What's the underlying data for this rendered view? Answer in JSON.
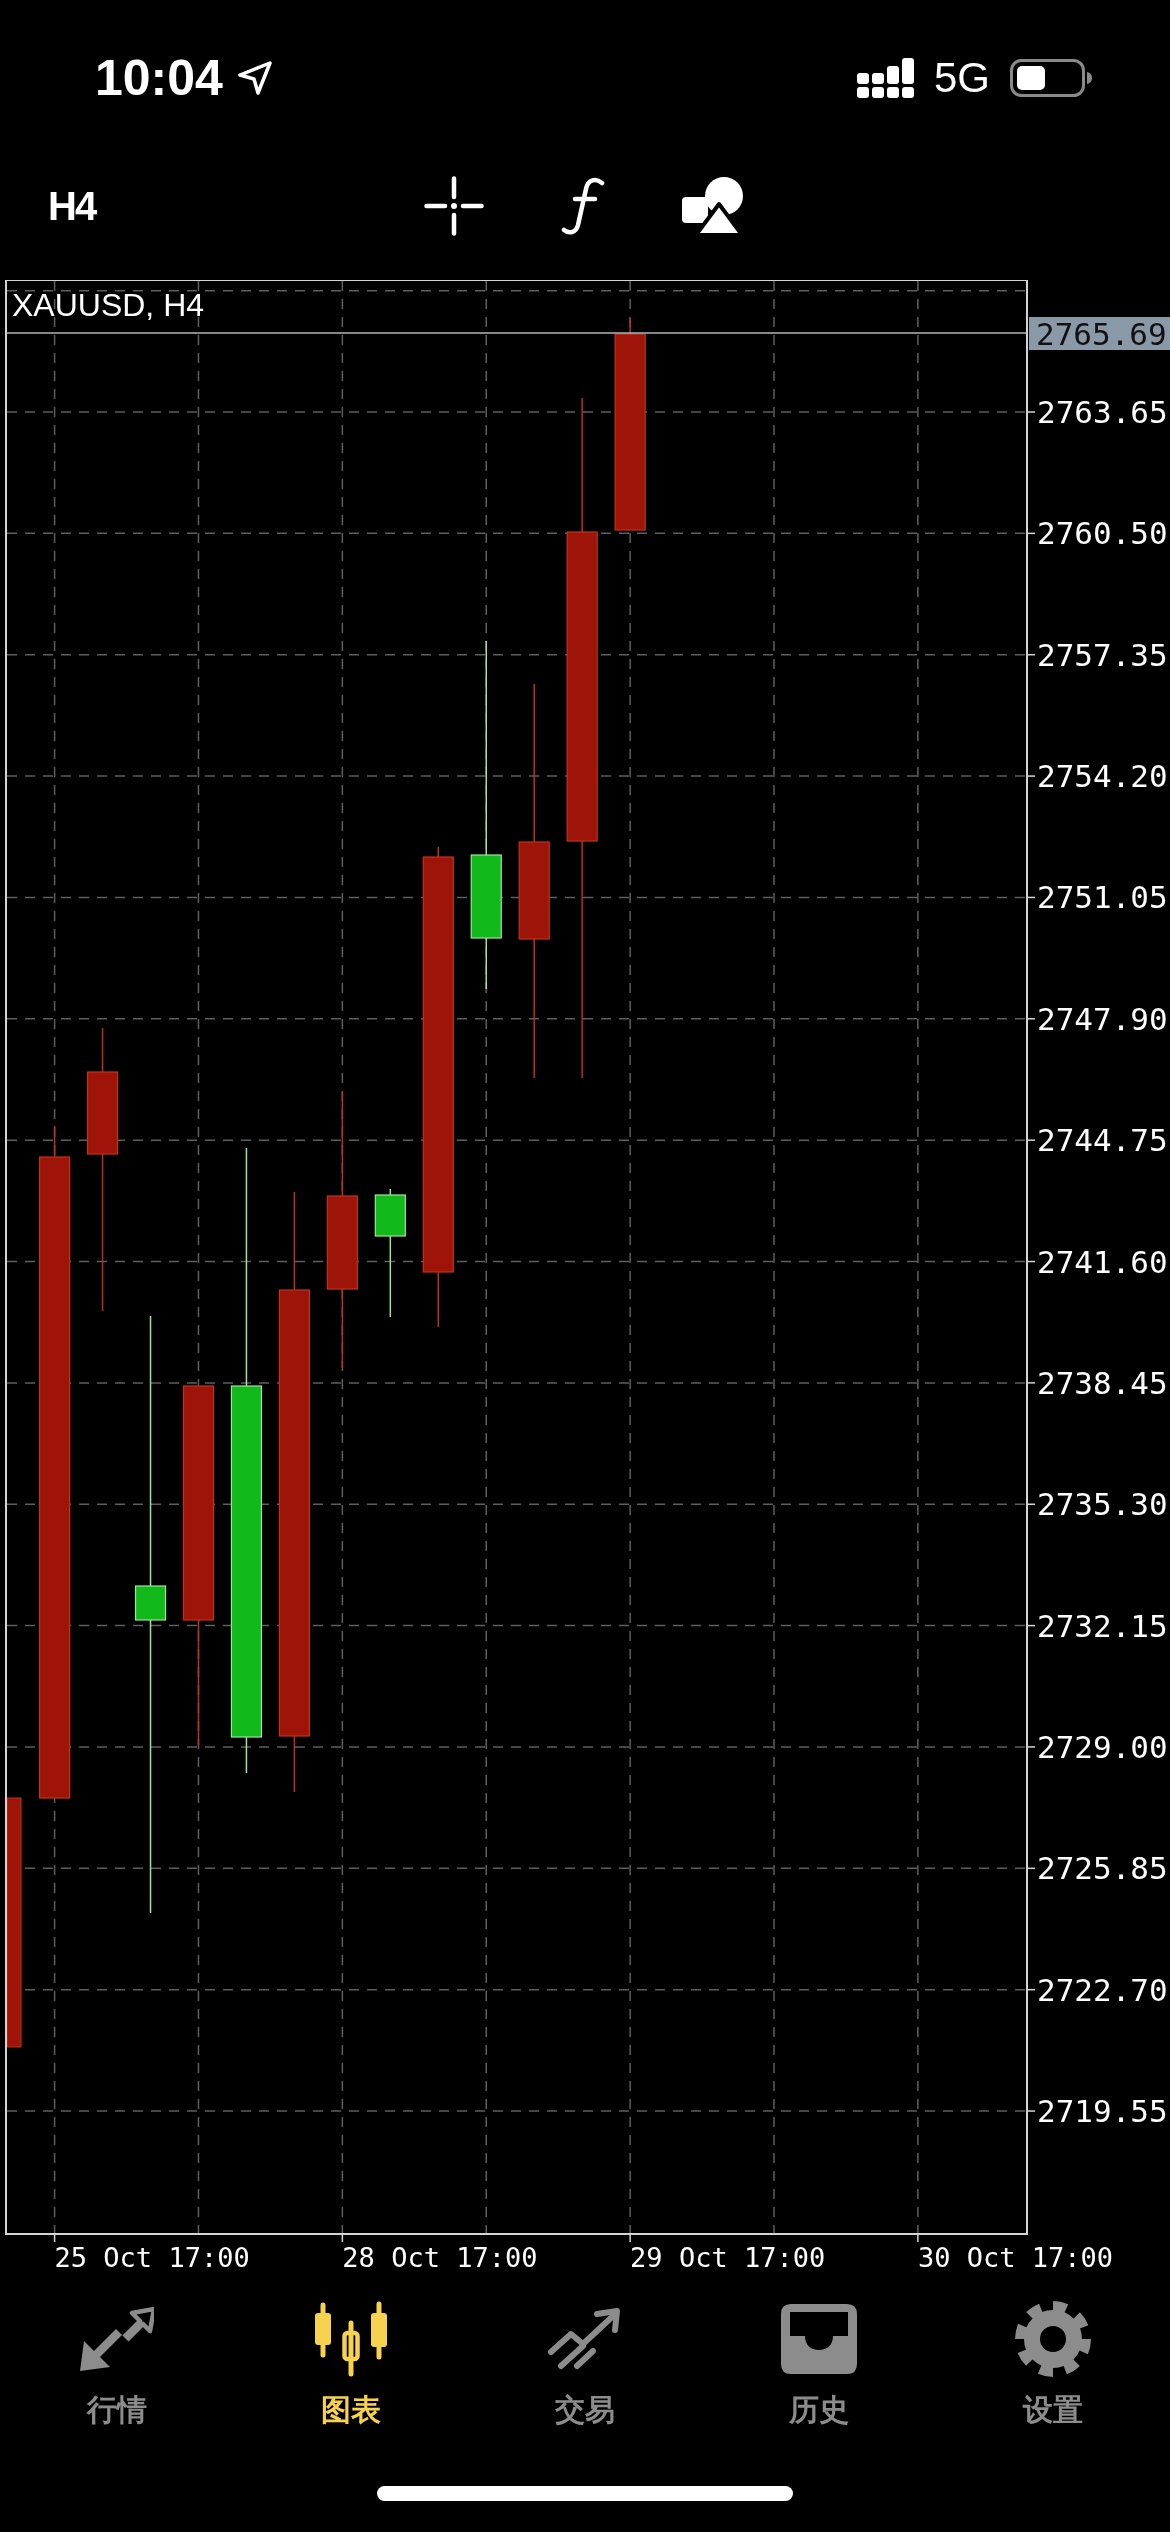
{
  "status_bar": {
    "time": "10:04",
    "network": "5G"
  },
  "toolbar": {
    "timeframe": "H4"
  },
  "chart": {
    "title": "XAUUSD, H4",
    "current_price": "2765.69",
    "price_labels": [
      "2763.65",
      "2760.50",
      "2757.35",
      "2754.20",
      "2751.05",
      "2747.90",
      "2744.75",
      "2741.60",
      "2738.45",
      "2735.30",
      "2732.15",
      "2729.00",
      "2725.85",
      "2722.70",
      "2719.55"
    ],
    "time_labels": [
      "25 Oct 17:00",
      "28 Oct 17:00",
      "29 Oct 17:00",
      "30 Oct 17:00"
    ]
  },
  "tab_bar": {
    "tabs": [
      {
        "label": "行情",
        "selected": false
      },
      {
        "label": "图表",
        "selected": true
      },
      {
        "label": "交易",
        "selected": false
      },
      {
        "label": "历史",
        "selected": false
      },
      {
        "label": "设置",
        "selected": false
      }
    ]
  }
}
